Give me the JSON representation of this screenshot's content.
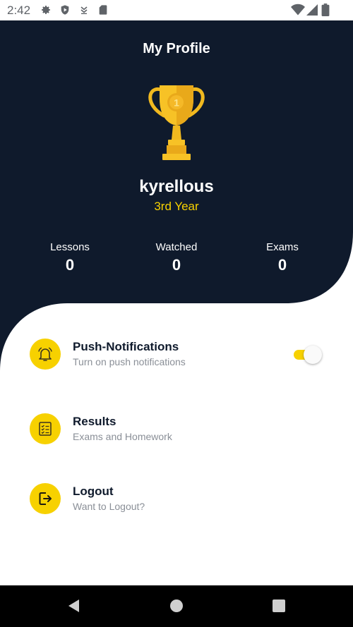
{
  "status_bar": {
    "time": "2:42",
    "left_icons": [
      "gear-icon",
      "shield-play-icon",
      "download-icon",
      "sd-card-icon"
    ],
    "right_icons": [
      "wifi-icon",
      "signal-icon",
      "battery-icon"
    ]
  },
  "header": {
    "title": "My Profile",
    "trophy_icon": "trophy-icon",
    "user_name": "kyrellous",
    "user_year": "3rd Year"
  },
  "stats": [
    {
      "label": "Lessons",
      "value": "0"
    },
    {
      "label": "Watched",
      "value": "0"
    },
    {
      "label": "Exams",
      "value": "0"
    }
  ],
  "menu": {
    "push": {
      "title": "Push-Notifications",
      "subtitle": "Turn on push notifications",
      "icon": "bell-icon",
      "enabled": true
    },
    "results": {
      "title": "Results",
      "subtitle": "Exams and Homework",
      "icon": "checklist-icon"
    },
    "logout": {
      "title": "Logout",
      "subtitle": "Want to Logout?",
      "icon": "logout-icon"
    }
  },
  "nav_bar": {
    "icons": [
      "back-triangle-icon",
      "home-circle-icon",
      "recents-square-icon"
    ]
  },
  "colors": {
    "navy": "#0f1a2c",
    "accent": "#f7d100",
    "muted": "#8a8f97"
  }
}
